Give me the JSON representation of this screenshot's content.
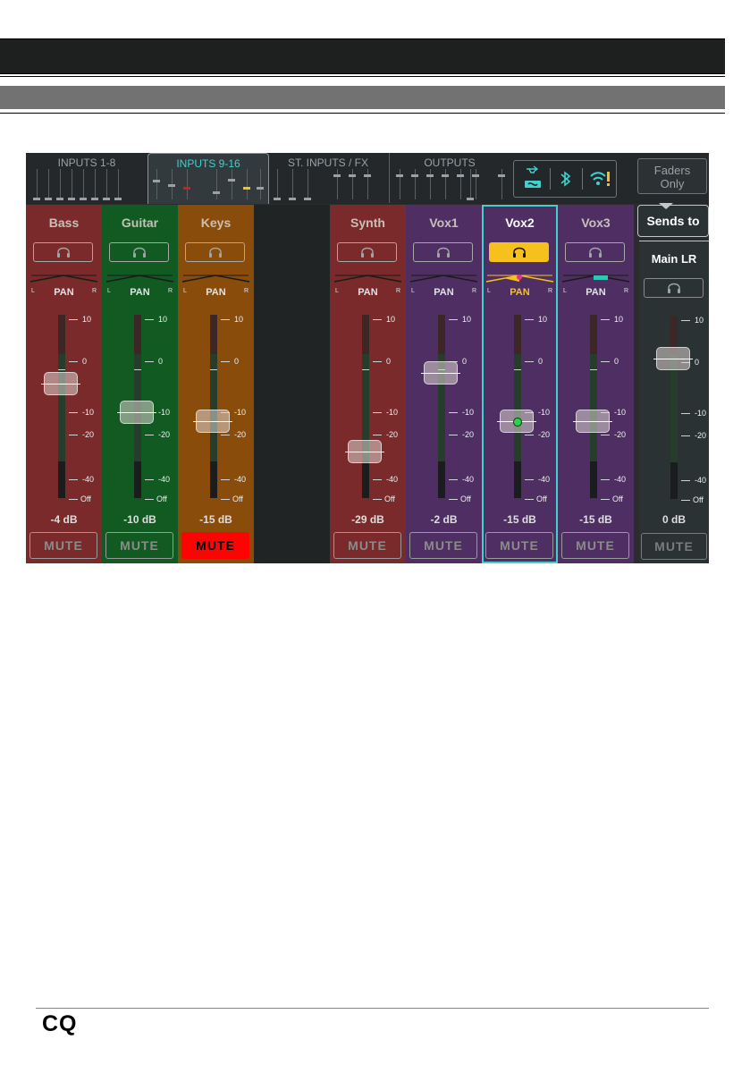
{
  "tabs": [
    {
      "label": "INPUTS 1-8",
      "active": false
    },
    {
      "label": "INPUTS 9-16",
      "active": true
    },
    {
      "label": "ST. INPUTS / FX",
      "active": false
    },
    {
      "label": "OUTPUTS",
      "active": false
    }
  ],
  "status_icons": [
    "usb-icon",
    "sd-card-icon",
    "bluetooth-icon",
    "wifi-warning-icon"
  ],
  "faders_only": {
    "line1": "Faders",
    "line2": "Only"
  },
  "channels": [
    {
      "name": "Bass",
      "level": "-4 dB",
      "mute": "MUTE",
      "muted": false,
      "selected": false,
      "listen": false,
      "color": "#7a2a2a"
    },
    {
      "name": "Guitar",
      "level": "-10 dB",
      "mute": "MUTE",
      "muted": false,
      "selected": false,
      "listen": false,
      "color": "#115a22"
    },
    {
      "name": "Keys",
      "level": "-15 dB",
      "mute": "MUTE",
      "muted": true,
      "selected": false,
      "listen": false,
      "color": "#8a4c0a"
    },
    {
      "name": "",
      "level": "",
      "mute": "",
      "muted": false,
      "selected": false,
      "listen": false,
      "color": "#202424"
    },
    {
      "name": "Synth",
      "level": "-29 dB",
      "mute": "MUTE",
      "muted": false,
      "selected": false,
      "listen": false,
      "color": "#7a2a2a"
    },
    {
      "name": "Vox1",
      "level": "-2 dB",
      "mute": "MUTE",
      "muted": false,
      "selected": false,
      "listen": false,
      "color": "#4f2f63"
    },
    {
      "name": "Vox2",
      "level": "-15 dB",
      "mute": "MUTE",
      "muted": false,
      "selected": true,
      "listen": true,
      "color": "#4f2f63"
    },
    {
      "name": "Vox3",
      "level": "-15 dB",
      "mute": "MUTE",
      "muted": false,
      "selected": false,
      "listen": false,
      "color": "#4f2f63"
    }
  ],
  "pan": {
    "label": "PAN",
    "left": "L",
    "right": "R"
  },
  "scale": [
    "10",
    "0",
    "-10",
    "-20",
    "-40",
    "Off"
  ],
  "master": {
    "sends_to": "Sends to",
    "name": "Main LR",
    "level": "0 dB",
    "mute": "MUTE"
  },
  "footer": {
    "logo": "CQ"
  },
  "colors": {
    "accent": "#3fd1cf",
    "listen": "#f7c11d",
    "mute_on": "#ff0202"
  }
}
